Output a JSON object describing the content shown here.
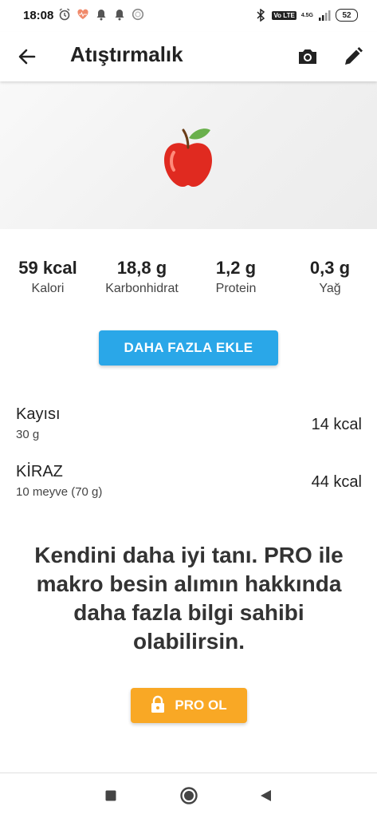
{
  "status_bar": {
    "time": "18:08",
    "battery": "52",
    "volte": "Vo LTE",
    "network": "4.5G"
  },
  "app_bar": {
    "title": "Atıştırmalık"
  },
  "macros": [
    {
      "value": "59 kcal",
      "label": "Kalori"
    },
    {
      "value": "18,8 g",
      "label": "Karbonhidrat"
    },
    {
      "value": "1,2 g",
      "label": "Protein"
    },
    {
      "value": "0,3 g",
      "label": "Yağ"
    }
  ],
  "add_more_label": "DAHA FAZLA EKLE",
  "foods": [
    {
      "name": "Kayısı",
      "quantity": "30 g",
      "kcal": "14 kcal"
    },
    {
      "name": "KİRAZ",
      "quantity": "10 meyve (70 g)",
      "kcal": "44 kcal"
    }
  ],
  "promo_text": "Kendini daha iyi tanı. PRO ile makro besin alımın hakkında daha fazla bilgi sahibi olabilirsin.",
  "pro_button_label": "PRO OL",
  "colors": {
    "accent_blue": "#2aa7e8",
    "pro_orange": "#f9a825"
  }
}
